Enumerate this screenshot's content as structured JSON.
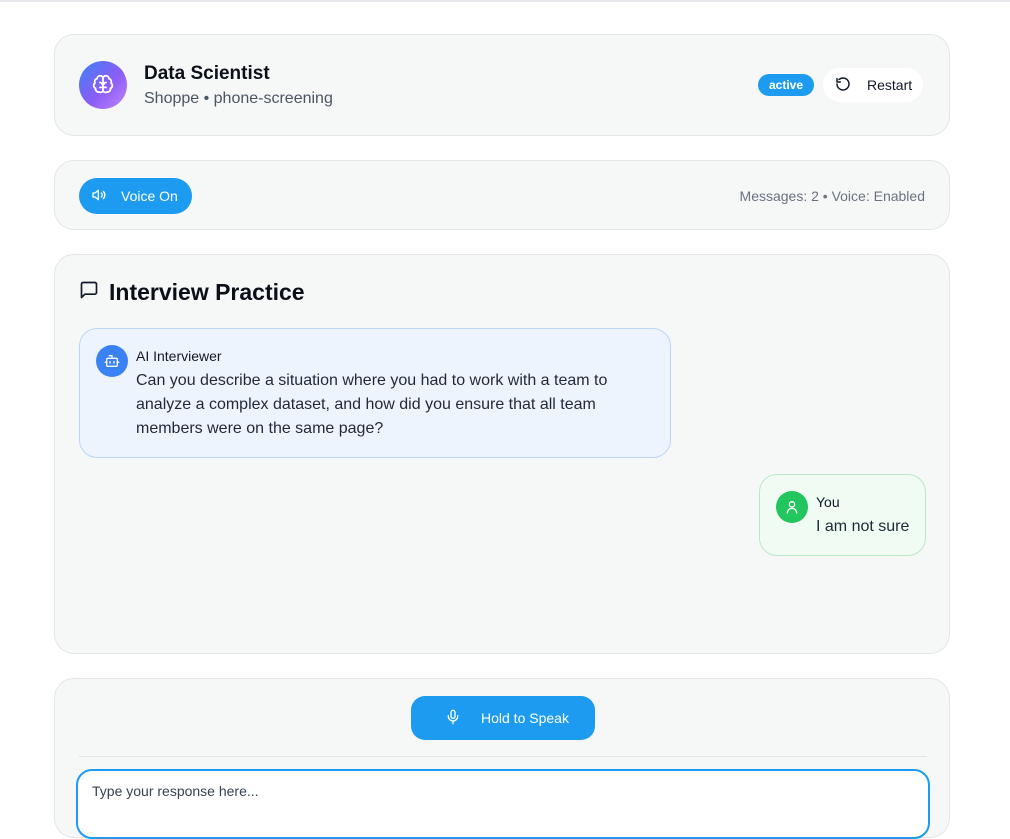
{
  "header": {
    "title": "Data Scientist",
    "subtitle": "Shoppe • phone-screening",
    "status": "active",
    "restart_label": "Restart",
    "icon": "brain-icon"
  },
  "voice_bar": {
    "voice_label": "Voice On",
    "meta": "Messages: 2 • Voice: Enabled",
    "icon": "volume-icon"
  },
  "chat": {
    "title": "Interview Practice",
    "messages": [
      {
        "sender": "AI Interviewer",
        "text": "Can you describe a situation where you had to work with a team to analyze a complex dataset, and how did you ensure that all team members were on the same page?",
        "icon": "bot-icon"
      },
      {
        "sender": "You",
        "text": "I am not sure",
        "icon": "user-icon"
      }
    ]
  },
  "input": {
    "speak_label": "Hold to Speak",
    "placeholder": "Type your response here...",
    "value": ""
  },
  "colors": {
    "accent": "#1d9bf0",
    "ai_bubble": "#eef4fd",
    "user_bubble": "#effbf3",
    "user_avatar": "#22c55e",
    "ai_avatar": "#3b82f6"
  }
}
